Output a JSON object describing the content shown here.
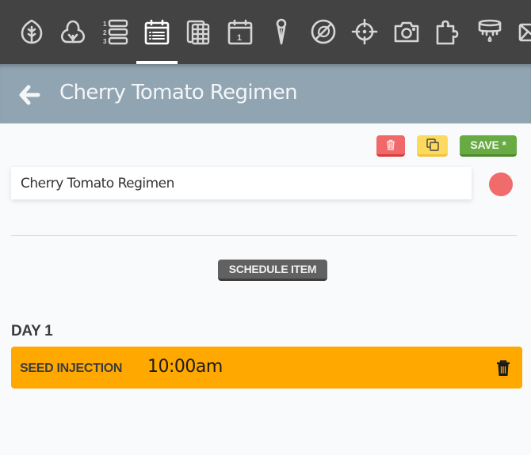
{
  "nav": {
    "items": [
      {
        "id": "crops",
        "icon": "leaf-icon",
        "label": "Crops",
        "active": false
      },
      {
        "id": "plants",
        "icon": "plant-icon",
        "label": "Plants",
        "active": false
      },
      {
        "id": "sequences",
        "icon": "numbered-list-icon",
        "label": "Sequences",
        "active": false
      },
      {
        "id": "regimens",
        "icon": "calendar-list-icon",
        "label": "Regimens",
        "active": true
      },
      {
        "id": "groups",
        "icon": "grid-stack-icon",
        "label": "Groups",
        "active": false
      },
      {
        "id": "events",
        "icon": "calendar-day-icon",
        "label": "Events",
        "active": false
      },
      {
        "id": "points",
        "icon": "map-pin-icon",
        "label": "Points",
        "active": false
      },
      {
        "id": "weeds",
        "icon": "no-weed-icon",
        "label": "Weeds",
        "active": false
      },
      {
        "id": "controls",
        "icon": "crosshair-icon",
        "label": "Controls",
        "active": false
      },
      {
        "id": "photos",
        "icon": "camera-icon",
        "label": "Photos",
        "active": false
      },
      {
        "id": "farmware",
        "icon": "puzzle-icon",
        "label": "Farmware",
        "active": false
      },
      {
        "id": "tools",
        "icon": "seed-dispenser-icon",
        "label": "Tools",
        "active": false
      },
      {
        "id": "messages",
        "icon": "envelope-icon",
        "label": "Messages",
        "active": false
      }
    ]
  },
  "header": {
    "back_icon": "arrow-left-icon",
    "title": "Cherry Tomato Regimen"
  },
  "toolbar": {
    "delete_icon": "trash-icon",
    "copy_icon": "copy-icon",
    "save_label": "SAVE *"
  },
  "form": {
    "name_value": "Cherry Tomato Regimen",
    "color": "#f06b6b"
  },
  "schedule": {
    "button_label": "SCHEDULE ITEM",
    "days": [
      {
        "label": "DAY 1",
        "items": [
          {
            "name": "SEED INJECTION",
            "time": "10:00am",
            "color": "#ffa800"
          }
        ]
      }
    ]
  },
  "colors": {
    "nav_bg": "#434343",
    "header_bg": "#90a4b1",
    "delete": "#f0686a",
    "copy": "#fdd95d",
    "save": "#67ab42",
    "schedule_button": "#616161"
  }
}
